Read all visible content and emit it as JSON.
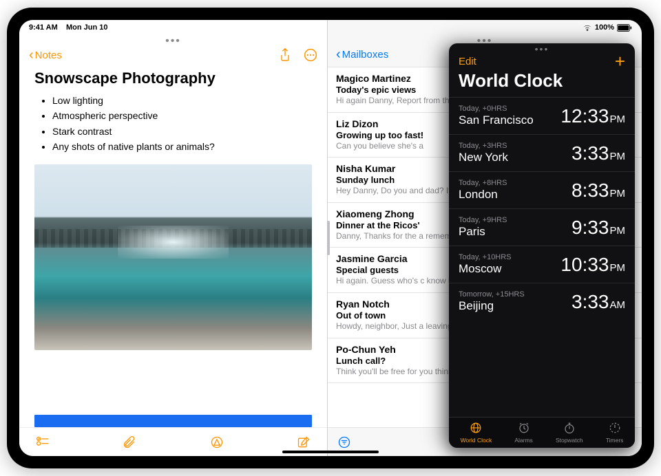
{
  "status": {
    "time": "9:41 AM",
    "date": "Mon Jun 10",
    "battery": "100%"
  },
  "notes": {
    "back_label": "Notes",
    "title": "Snowscape Photography",
    "items": [
      "Low lighting",
      "Atmospheric perspective",
      "Stark contrast",
      "Any shots of native plants or animals?"
    ]
  },
  "mail": {
    "back_label": "Mailboxes",
    "messages": [
      {
        "from": "Magico Martinez",
        "subject": "Today's epic views",
        "preview": "Hi again Danny, Report from the field: Wide open skies, a ger"
      },
      {
        "from": "Liz Dizon",
        "subject": "Growing up too fast!",
        "preview": "Can you believe she's a"
      },
      {
        "from": "Nisha Kumar",
        "subject": "Sunday lunch",
        "preview": "Hey Danny, Do you and dad? If you two join, th"
      },
      {
        "from": "Xiaomeng Zhong",
        "subject": "Dinner at the Ricos'",
        "preview": "Danny, Thanks for the a remembered to take or"
      },
      {
        "from": "Jasmine Garcia",
        "subject": "Special guests",
        "preview": "Hi again. Guess who's c know how to make me"
      },
      {
        "from": "Ryan Notch",
        "subject": "Out of town",
        "preview": "Howdy, neighbor, Just a leaving Tuesday and w"
      },
      {
        "from": "Po-Chun Yeh",
        "subject": "Lunch call?",
        "preview": "Think you'll be free for you think might work a"
      }
    ]
  },
  "clock": {
    "edit_label": "Edit",
    "title": "World Clock",
    "cities": [
      {
        "offset": "Today, +0HRS",
        "city": "San Francisco",
        "time": "12:33",
        "unit": "PM"
      },
      {
        "offset": "Today, +3HRS",
        "city": "New York",
        "time": "3:33",
        "unit": "PM"
      },
      {
        "offset": "Today, +8HRS",
        "city": "London",
        "time": "8:33",
        "unit": "PM"
      },
      {
        "offset": "Today, +9HRS",
        "city": "Paris",
        "time": "9:33",
        "unit": "PM"
      },
      {
        "offset": "Today, +10HRS",
        "city": "Moscow",
        "time": "10:33",
        "unit": "PM"
      },
      {
        "offset": "Tomorrow, +15HRS",
        "city": "Beijing",
        "time": "3:33",
        "unit": "AM"
      }
    ],
    "tabs": [
      {
        "label": "World Clock",
        "icon": "globe",
        "active": true
      },
      {
        "label": "Alarms",
        "icon": "alarm",
        "active": false
      },
      {
        "label": "Stopwatch",
        "icon": "stopwatch",
        "active": false
      },
      {
        "label": "Timers",
        "icon": "timer",
        "active": false
      }
    ]
  }
}
